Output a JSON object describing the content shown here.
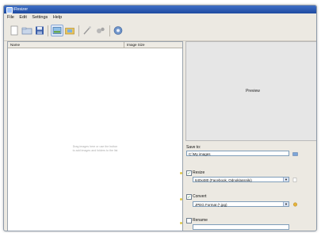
{
  "window": {
    "title": "iResizer"
  },
  "menu": [
    "File",
    "Edit",
    "Settings",
    "Help"
  ],
  "toolbar": {
    "icons": [
      "new-icon",
      "open-icon",
      "save-icon",
      "add-images-icon",
      "add-folder-icon",
      "wand-icon",
      "tools-icon",
      "help-icon"
    ]
  },
  "list": {
    "col_name": "Name",
    "col_size": "Image Size",
    "hint_line1": "Drag images here or use the button",
    "hint_line2": "to add images and folders to the list"
  },
  "preview": {
    "label": "Preview"
  },
  "save": {
    "label": "Save to:",
    "path": "C:\\My images"
  },
  "resize": {
    "label": "Resize",
    "checked": true,
    "option": "640x480 (Facebook, Odnoklassniki)"
  },
  "convert": {
    "label": "Convert",
    "checked": true,
    "option": "JPEG Format (*.jpg)"
  },
  "rename": {
    "label": "Rename",
    "checked": false,
    "value": ""
  },
  "colors": {
    "titlebar": "#2a58b0",
    "accent": "#e0c84a"
  }
}
